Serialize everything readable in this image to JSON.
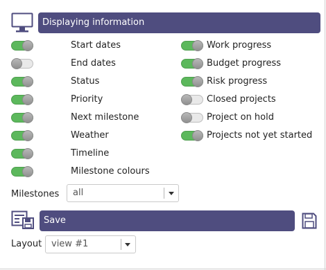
{
  "display_section": {
    "title": "Displaying information",
    "icon": "monitor-icon"
  },
  "left_toggles": [
    {
      "label": "Start dates",
      "on": true
    },
    {
      "label": "End dates",
      "on": false
    },
    {
      "label": "Status",
      "on": true
    },
    {
      "label": "Priority",
      "on": true
    },
    {
      "label": "Next milestone",
      "on": true
    },
    {
      "label": "Weather",
      "on": true
    },
    {
      "label": "Timeline",
      "on": true
    },
    {
      "label": "Milestone colours",
      "on": true
    }
  ],
  "right_toggles": [
    {
      "label": "Work progress",
      "on": true
    },
    {
      "label": "Budget progress",
      "on": true
    },
    {
      "label": "Risk progress",
      "on": true
    },
    {
      "label": "Closed projects",
      "on": false
    },
    {
      "label": "Project on hold",
      "on": false
    },
    {
      "label": "Projects not yet started",
      "on": true
    }
  ],
  "milestones": {
    "label": "Milestones",
    "value": "all"
  },
  "save_section": {
    "title": "Save",
    "layout_icon": "layout-save-icon",
    "save_icon": "floppy-disk-icon"
  },
  "layout": {
    "label": "Layout",
    "value": "view #1"
  },
  "colors": {
    "accent": "#4f4d7f",
    "toggle_on": "#5cb85c",
    "toggle_off": "#e9e9e9"
  }
}
